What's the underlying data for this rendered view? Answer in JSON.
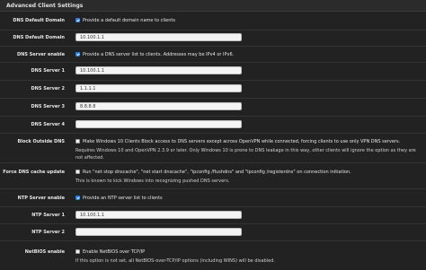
{
  "panel": {
    "title": "Advanced Client Settings"
  },
  "dns_default_domain": {
    "label": "DNS Default Domain",
    "checkbox_text": "Provide a default domain name to clients",
    "field_label": "DNS Default Domain",
    "value": "10.100.1.1"
  },
  "dns_server_enable": {
    "label": "DNS Server enable",
    "checkbox_text": "Provide a DNS server list to clients. Addresses may be IPv4 or IPv6."
  },
  "dns_servers": [
    {
      "label": "DNS Server 1",
      "value": "10.100.1.1"
    },
    {
      "label": "DNS Server 2",
      "value": "1.1.1.1"
    },
    {
      "label": "DNS Server 3",
      "value": "8.8.8.8"
    },
    {
      "label": "DNS Server 4",
      "value": ""
    }
  ],
  "block_outside_dns": {
    "label": "Block Outside DNS",
    "checkbox_text": "Make Windows 10 Clients Block access to DNS servers except across OpenVPN while connected, forcing clients to use only VPN DNS servers.",
    "help_1": "Requires Windows 10 and OpenVPN 2.3.9 or later. Only Windows 10 is prone to DNS leakage in this way, other clients will ignore the option as they are",
    "help_2": "not affected."
  },
  "force_dns_cache": {
    "label": "Force DNS cache update",
    "checkbox_text": "Run \"net stop dnscache\", \"net start dnscache\", \"ipconfig /flushdns\" and \"ipconfig /registerdns\" on connection initiation.",
    "help": "This is known to kick Windows into recognizing pushed DNS servers."
  },
  "ntp_server_enable": {
    "label": "NTP Server enable",
    "checkbox_text": "Provide an NTP server list to clients"
  },
  "ntp_servers": [
    {
      "label": "NTP Server 1",
      "value": "10.100.1.1"
    },
    {
      "label": "NTP Server 2",
      "value": ""
    }
  ],
  "netbios": {
    "label": "NetBIOS enable",
    "checkbox_text": "Enable NetBIOS over TCP/IP",
    "help": "If this option is not set, all NetBIOS-over-TCP/IP options (including WINS) will be disabled."
  },
  "colors": {
    "checkbox_on": "#2a7fd4",
    "background": "#222222"
  }
}
